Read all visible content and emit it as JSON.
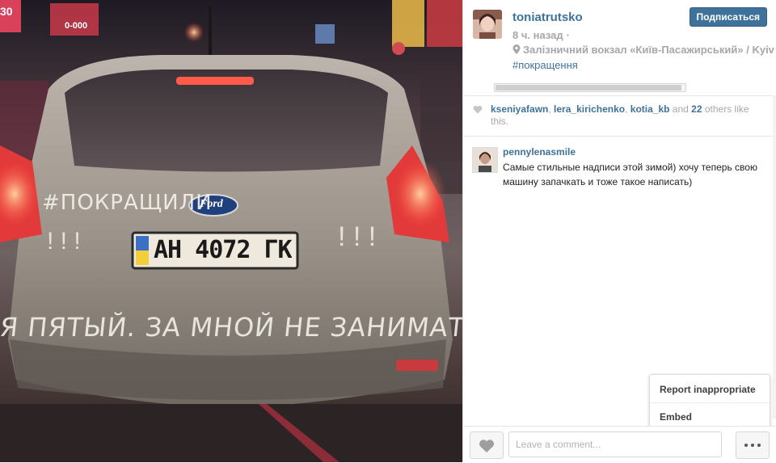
{
  "post": {
    "username": "toniatrutsko",
    "time": "8 ч. назад",
    "location": "Залізничний вокзал «Київ-Пасажирський» / Kyiv",
    "hashtag": "#покращення",
    "follow_label": "Подписаться"
  },
  "photo": {
    "graffiti_top": "#ПОКРАЩИЛИ",
    "graffiti_bottom": "Я ПЯТЫЙ. ЗА МНОЙ НЕ ЗАНИМАТЬ",
    "plate": "AH 4072 ГК",
    "badge": "Ford",
    "exclaim_left": "! ! !",
    "exclaim_right": "! ! !",
    "sign_top_left": "30",
    "sign_top_left2": "0-000"
  },
  "likes": {
    "users": [
      "kseniyafawn",
      "lera_kirichenko",
      "kotia_kb"
    ],
    "sep1": ", ",
    "sep2": ", ",
    "and": " and ",
    "count": "22",
    "suffix": " others like this."
  },
  "comments": [
    {
      "username": "pennylenasmile",
      "text": "Самые стильные надписи этой зимой) хочу теперь свою машину запачкать и тоже такое написать)"
    }
  ],
  "footer": {
    "comment_placeholder": "Leave a comment...",
    "comment_value": ""
  },
  "menu": {
    "report": "Report inappropriate",
    "embed": "Embed"
  },
  "icons": {
    "heart": "heart-icon",
    "more": "ellipsis-icon",
    "location": "location-pin-icon"
  }
}
